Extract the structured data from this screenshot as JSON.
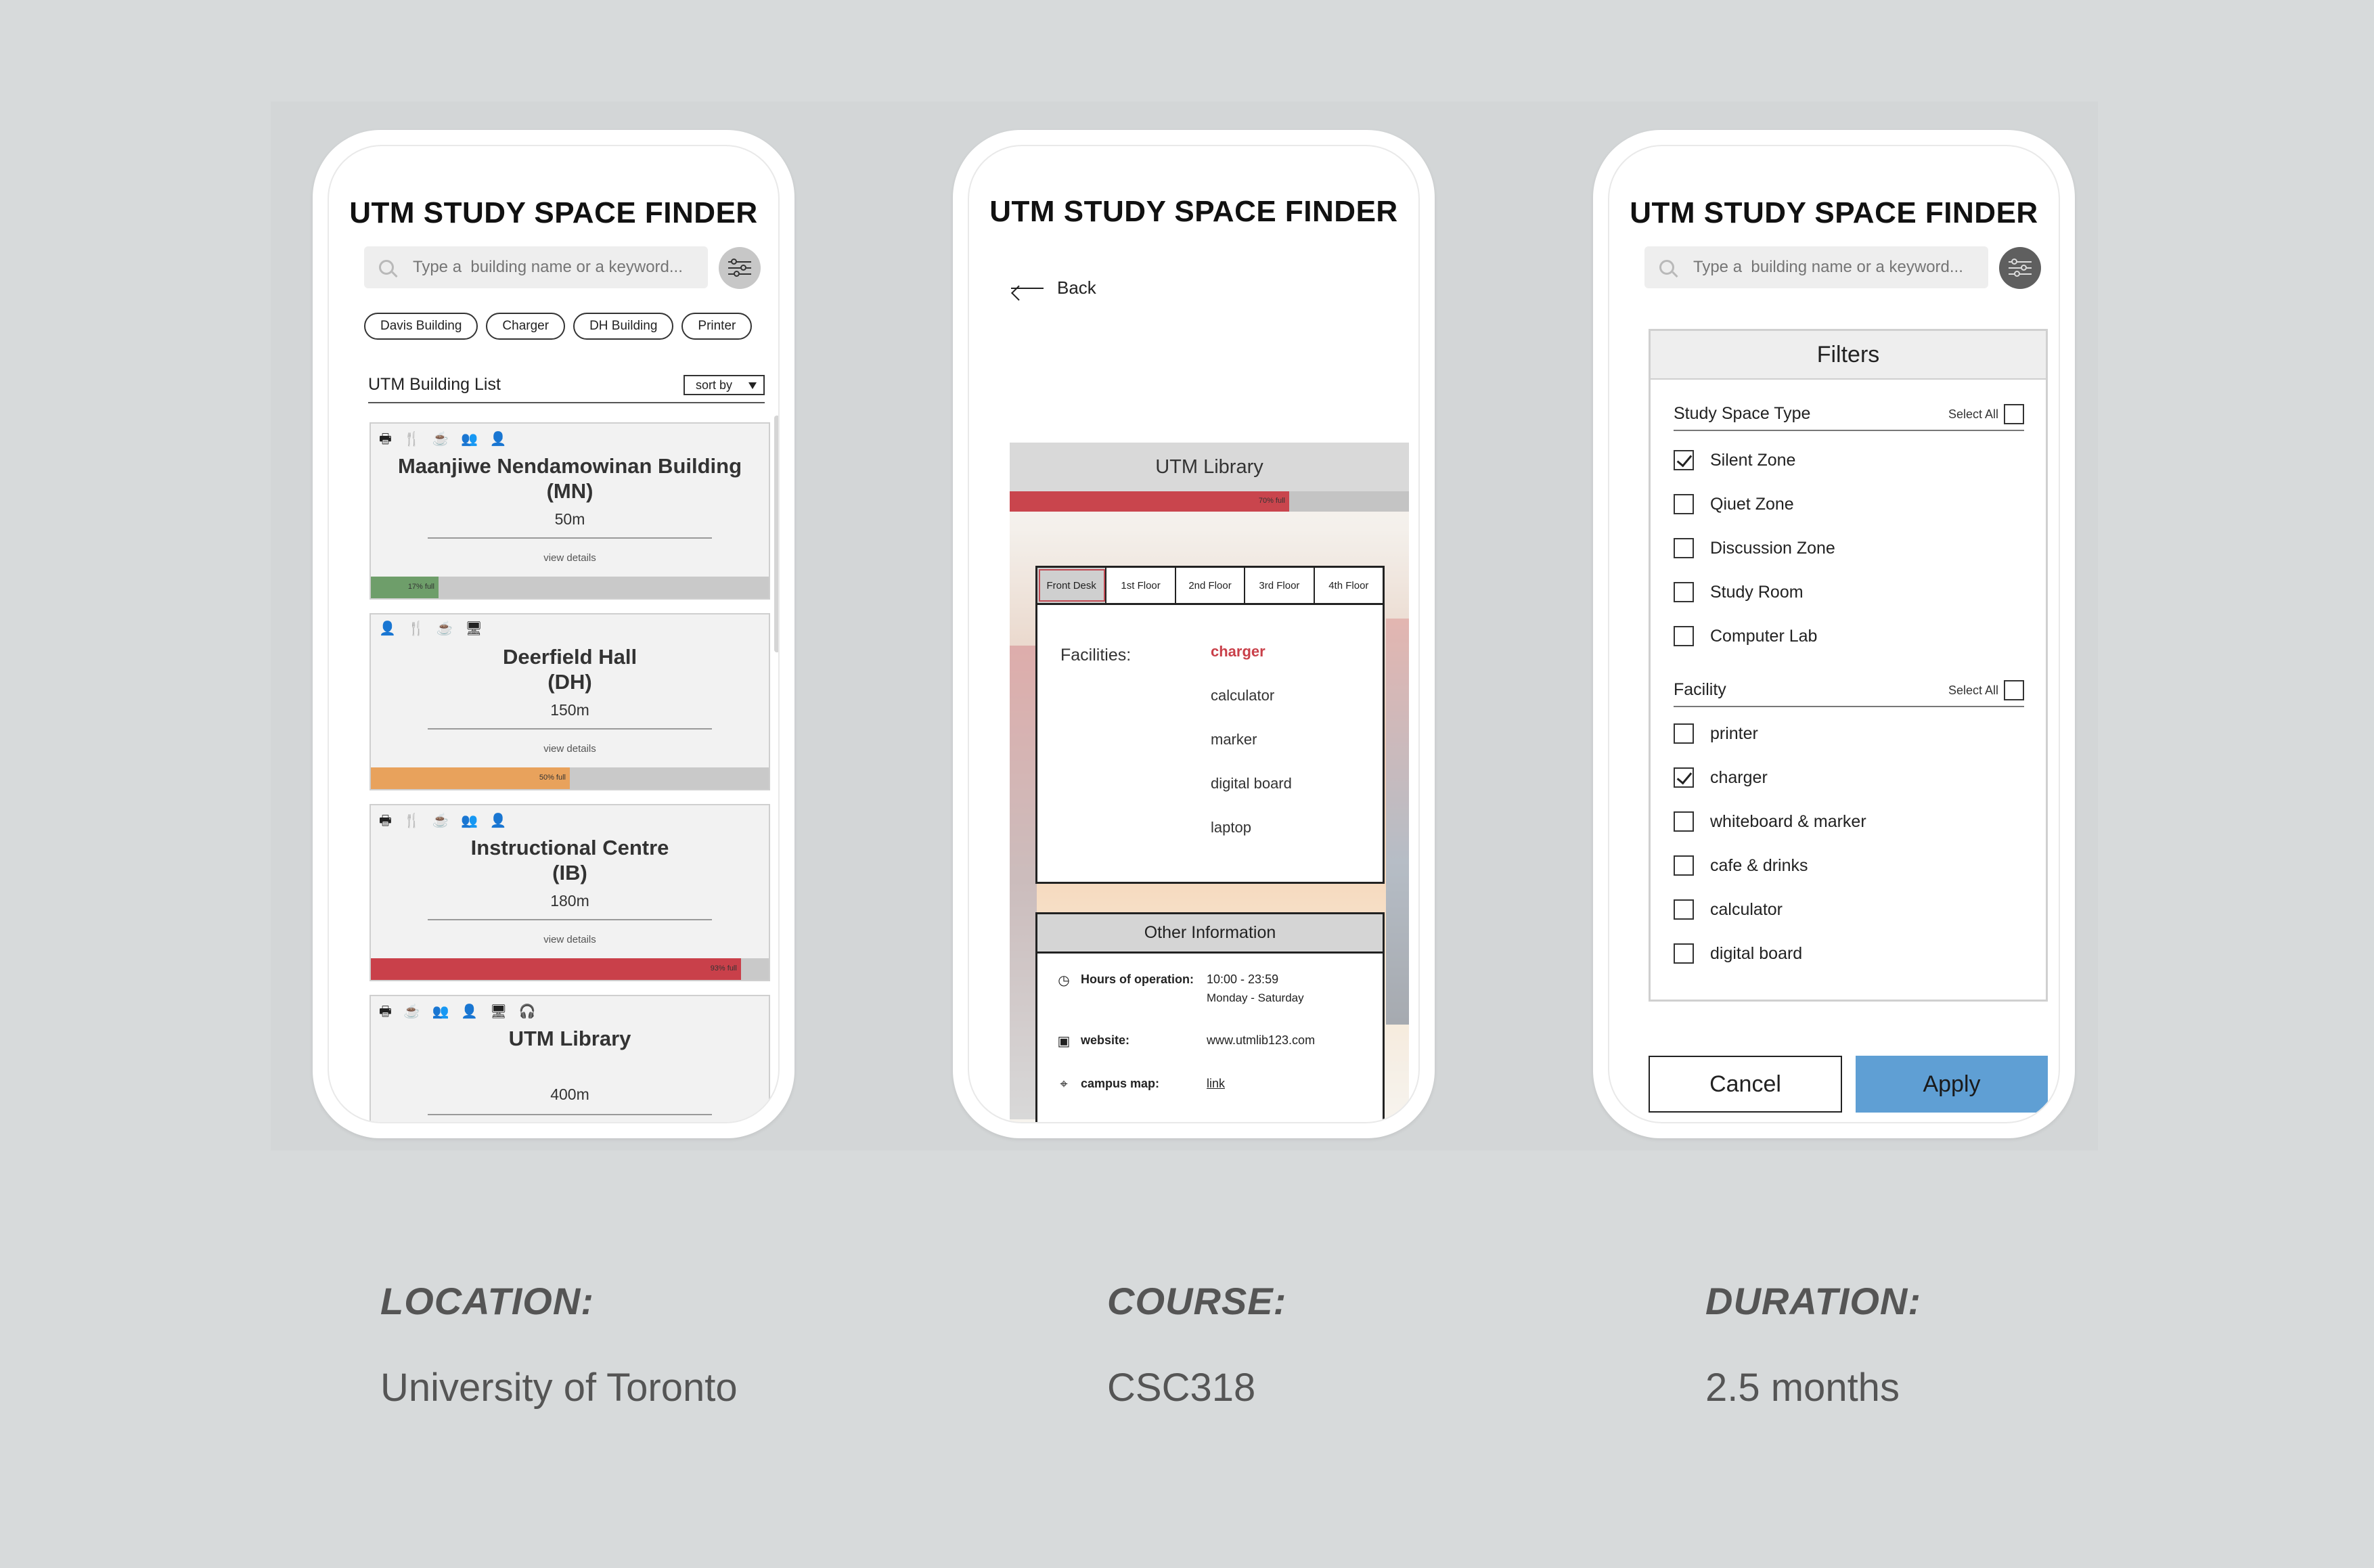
{
  "app_title": "UTM STUDY SPACE FINDER",
  "search": {
    "placeholder": "Type a  building name or a keyword..."
  },
  "chips": [
    "Davis Building",
    "Charger",
    "DH Building",
    "Printer"
  ],
  "list": {
    "label": "UTM Building List",
    "sort_label": "sort by",
    "details_label": "view details",
    "buildings": [
      {
        "icons": "🖶 🍴 ☕ 👥 👤",
        "name": "Maanjiwe Nendamowinan Building\n(MN)",
        "distance": "50m",
        "occupancy_label": "17% full",
        "occupancy": 0.17,
        "color": "#6e9e6a"
      },
      {
        "icons": "👤 🍴 ☕ 🖥",
        "name": "Deerfield Hall\n(DH)",
        "distance": "150m",
        "occupancy_label": "50% full",
        "occupancy": 0.5,
        "color": "#e8a25c"
      },
      {
        "icons": "🖶 🍴 ☕ 👥 👤",
        "name": "Instructional Centre\n(IB)",
        "distance": "180m",
        "occupancy_label": "93% full",
        "occupancy": 0.93,
        "color": "#c9404a"
      },
      {
        "icons": "🖶 ☕ 👥 👤 🖥 🎧",
        "name": "UTM Library",
        "distance": "400m"
      }
    ]
  },
  "detail": {
    "back_label": "Back",
    "building_name": "UTM Library",
    "occupancy_label": "70% full",
    "occupancy": 0.7,
    "tabs": [
      "Front Desk",
      "1st Floor",
      "2nd Floor",
      "3rd Floor",
      "4th Floor"
    ],
    "facilities_label": "Facilities:",
    "facilities": [
      "charger",
      "calculator",
      "marker",
      "digital board",
      "laptop"
    ],
    "other_info_title": "Other Information",
    "hours_key": "Hours of operation:",
    "hours_time": "10:00 - 23:59",
    "hours_days": "Monday - Saturday",
    "website_key": "website:",
    "website_value": "www.utmlib123.com",
    "map_key": "campus map:",
    "map_value": "link"
  },
  "filters": {
    "title": "Filters",
    "select_all_label": "Select All",
    "study_type_title": "Study Space Type",
    "study_types": [
      {
        "label": "Silent Zone",
        "checked": true
      },
      {
        "label": "Qiuet Zone",
        "checked": false
      },
      {
        "label": "Discussion Zone",
        "checked": false
      },
      {
        "label": "Study Room",
        "checked": false
      },
      {
        "label": "Computer Lab",
        "checked": false
      }
    ],
    "facility_title": "Facility",
    "facilities": [
      {
        "label": "printer",
        "checked": false
      },
      {
        "label": "charger",
        "checked": true
      },
      {
        "label": "whiteboard & marker",
        "checked": false
      },
      {
        "label": "cafe & drinks",
        "checked": false
      },
      {
        "label": "calculator",
        "checked": false
      },
      {
        "label": "digital board",
        "checked": false
      }
    ],
    "cancel_label": "Cancel",
    "apply_label": "Apply"
  },
  "meta": {
    "location_key": "LOCATION:",
    "location_value": "University of Toronto",
    "course_key": "COURSE:",
    "course_value": "CSC318",
    "duration_key": "DURATION:",
    "duration_value": "2.5 months"
  }
}
